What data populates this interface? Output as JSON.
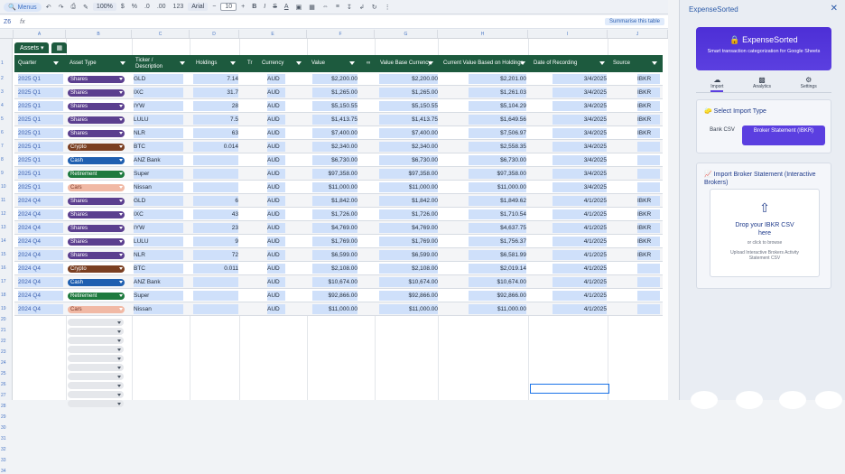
{
  "toolbar": {
    "menus": "Menus",
    "zoom": "100%",
    "currency": "$",
    "percent": "%",
    "dec1": ".0",
    "dec2": ".00",
    "fmt": "123",
    "font": "Arial",
    "font_size": "10"
  },
  "formula": {
    "cell_ref": "Z6",
    "fx": "fx",
    "summarize": "Summarise this table"
  },
  "columns": [
    "A",
    "B",
    "C",
    "D",
    "E",
    "F",
    "G",
    "H",
    "I",
    "J"
  ],
  "sheet": {
    "tab": "Assets",
    "headers": {
      "quarter": "Quarter",
      "asset_type": "Asset Type",
      "ticker": "Ticker / Description",
      "holdings": "Holdings",
      "tr": "Tr",
      "currency": "Currency",
      "value": "Value",
      "fx": "Value Base Currency",
      "cur_value": "Current Value Based on Holdings",
      "date": "Date of Recording",
      "source": "Source"
    },
    "rows": [
      {
        "q": "2025 Q1",
        "type": "Shares",
        "tick": "GLD",
        "hold": "7.14",
        "cur": "AUD",
        "val": "$2,200.00",
        "base": "$2,200.00",
        "cv": "$2,201.00",
        "date": "3/4/2025",
        "src": "IBKR"
      },
      {
        "q": "2025 Q1",
        "type": "Shares",
        "tick": "IXC",
        "hold": "31.7",
        "cur": "AUD",
        "val": "$1,265.00",
        "base": "$1,265.00",
        "cv": "$1,261.03",
        "date": "3/4/2025",
        "src": "IBKR"
      },
      {
        "q": "2025 Q1",
        "type": "Shares",
        "tick": "IYW",
        "hold": "28",
        "cur": "AUD",
        "val": "$5,150.55",
        "base": "$5,150.55",
        "cv": "$5,104.29",
        "date": "3/4/2025",
        "src": "IBKR"
      },
      {
        "q": "2025 Q1",
        "type": "Shares",
        "tick": "LULU",
        "hold": "7.5",
        "cur": "AUD",
        "val": "$1,413.75",
        "base": "$1,413.75",
        "cv": "$1,649.56",
        "date": "3/4/2025",
        "src": "IBKR"
      },
      {
        "q": "2025 Q1",
        "type": "Shares",
        "tick": "NLR",
        "hold": "63",
        "cur": "AUD",
        "val": "$7,400.00",
        "base": "$7,400.00",
        "cv": "$7,506.97",
        "date": "3/4/2025",
        "src": "IBKR"
      },
      {
        "q": "2025 Q1",
        "type": "Crypto",
        "tick": "BTC",
        "hold": "0.014",
        "cur": "AUD",
        "val": "$2,340.00",
        "base": "$2,340.00",
        "cv": "$2,558.35",
        "date": "3/4/2025",
        "src": ""
      },
      {
        "q": "2025 Q1",
        "type": "Cash",
        "tick": "ANZ Bank",
        "hold": "",
        "cur": "AUD",
        "val": "$6,730.00",
        "base": "$6,730.00",
        "cv": "$6,730.00",
        "date": "3/4/2025",
        "src": ""
      },
      {
        "q": "2025 Q1",
        "type": "Retirement",
        "tick": "Super",
        "hold": "",
        "cur": "AUD",
        "val": "$97,358.00",
        "base": "$97,358.00",
        "cv": "$97,358.00",
        "date": "3/4/2025",
        "src": ""
      },
      {
        "q": "2025 Q1",
        "type": "Cars",
        "tick": "Nissan",
        "hold": "",
        "cur": "AUD",
        "val": "$11,000.00",
        "base": "$11,000.00",
        "cv": "$11,000.00",
        "date": "3/4/2025",
        "src": ""
      },
      {
        "q": "2024 Q4",
        "type": "Shares",
        "tick": "GLD",
        "hold": "6",
        "cur": "AUD",
        "val": "$1,842.00",
        "base": "$1,842.00",
        "cv": "$1,849.62",
        "date": "4/1/2025",
        "src": "IBKR"
      },
      {
        "q": "2024 Q4",
        "type": "Shares",
        "tick": "IXC",
        "hold": "43",
        "cur": "AUD",
        "val": "$1,726.00",
        "base": "$1,726.00",
        "cv": "$1,710.54",
        "date": "4/1/2025",
        "src": "IBKR"
      },
      {
        "q": "2024 Q4",
        "type": "Shares",
        "tick": "IYW",
        "hold": "23",
        "cur": "AUD",
        "val": "$4,769.00",
        "base": "$4,769.00",
        "cv": "$4,637.75",
        "date": "4/1/2025",
        "src": "IBKR"
      },
      {
        "q": "2024 Q4",
        "type": "Shares",
        "tick": "LULU",
        "hold": "9",
        "cur": "AUD",
        "val": "$1,769.00",
        "base": "$1,769.00",
        "cv": "$1,756.37",
        "date": "4/1/2025",
        "src": "IBKR"
      },
      {
        "q": "2024 Q4",
        "type": "Shares",
        "tick": "NLR",
        "hold": "72",
        "cur": "AUD",
        "val": "$6,599.00",
        "base": "$6,599.00",
        "cv": "$6,581.99",
        "date": "4/1/2025",
        "src": "IBKR"
      },
      {
        "q": "2024 Q4",
        "type": "Crypto",
        "tick": "BTC",
        "hold": "0.011",
        "cur": "AUD",
        "val": "$2,108.00",
        "base": "$2,108.00",
        "cv": "$2,019.14",
        "date": "4/1/2025",
        "src": ""
      },
      {
        "q": "2024 Q4",
        "type": "Cash",
        "tick": "ANZ Bank",
        "hold": "",
        "cur": "AUD",
        "val": "$10,674.00",
        "base": "$10,674.00",
        "cv": "$10,674.00",
        "date": "4/1/2025",
        "src": ""
      },
      {
        "q": "2024 Q4",
        "type": "Retirement",
        "tick": "Super",
        "hold": "",
        "cur": "AUD",
        "val": "$92,866.00",
        "base": "$92,866.00",
        "cv": "$92,866.00",
        "date": "4/1/2025",
        "src": ""
      },
      {
        "q": "2024 Q4",
        "type": "Cars",
        "tick": "Nissan",
        "hold": "",
        "cur": "AUD",
        "val": "$11,000.00",
        "base": "$11,000.00",
        "cv": "$11,000.00",
        "date": "4/1/2025",
        "src": ""
      }
    ]
  },
  "chip_colors": {
    "Shares": "#5b3f8f",
    "Crypto": "#7a3f22",
    "Cash": "#1f5fb0",
    "Retirement": "#1e7a3e",
    "Cars": "#f1b9a5"
  },
  "panel": {
    "title": "ExpenseSorted",
    "hero_title": "ExpenseSorted",
    "hero_sub": "Smart transaction categorization for Google Sheets",
    "nav": [
      "Import",
      "Analytics",
      "Settings"
    ],
    "select_title": "Select Import Type",
    "opt_bank": "Bank CSV",
    "opt_broker": "Broker Statement (IBKR)",
    "import_title": "Import Broker Statement (Interactive Brokers)",
    "drop_title": "Drop your IBKR CSV here",
    "drop_or": "or click to browse",
    "drop_hint": "Upload Interactive Brokers Activity Statement CSV"
  }
}
